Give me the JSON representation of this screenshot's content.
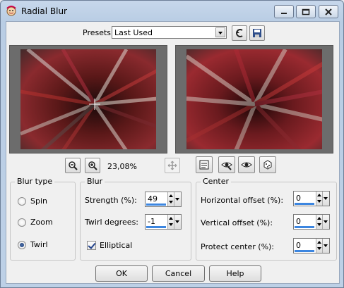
{
  "window": {
    "title": "Radial Blur"
  },
  "presets": {
    "label": "Presets:",
    "value": "Last Used"
  },
  "zoom": {
    "level": "23,08%"
  },
  "blur_type": {
    "title": "Blur type",
    "options": [
      {
        "label": "Spin",
        "checked": false
      },
      {
        "label": "Zoom",
        "checked": false
      },
      {
        "label": "Twirl",
        "checked": true
      }
    ]
  },
  "blur": {
    "title": "Blur",
    "strength": {
      "label": "Strength (%):",
      "value": "49"
    },
    "twirl": {
      "label": "Twirl degrees:",
      "value": "-1"
    },
    "elliptical": {
      "label": "Elliptical",
      "checked": true
    }
  },
  "center": {
    "title": "Center",
    "horizontal": {
      "label": "Horizontal offset (%):",
      "value": "0"
    },
    "vertical": {
      "label": "Vertical offset (%):",
      "value": "0"
    },
    "protect": {
      "label": "Protect center (%):",
      "value": "0"
    }
  },
  "buttons": {
    "ok": "OK",
    "cancel": "Cancel",
    "help": "Help"
  },
  "colors": {
    "accent": "#3c86e0",
    "title_bg": "#bdd0e6"
  },
  "icons": [
    "app-icon",
    "minimize-icon",
    "maximize-icon",
    "close-icon",
    "reset-icon",
    "save-preset-icon",
    "zoom-out-icon",
    "zoom-in-icon",
    "pan-icon",
    "proof-icon",
    "auto-proof-icon",
    "eye-icon",
    "randomize-icon"
  ]
}
